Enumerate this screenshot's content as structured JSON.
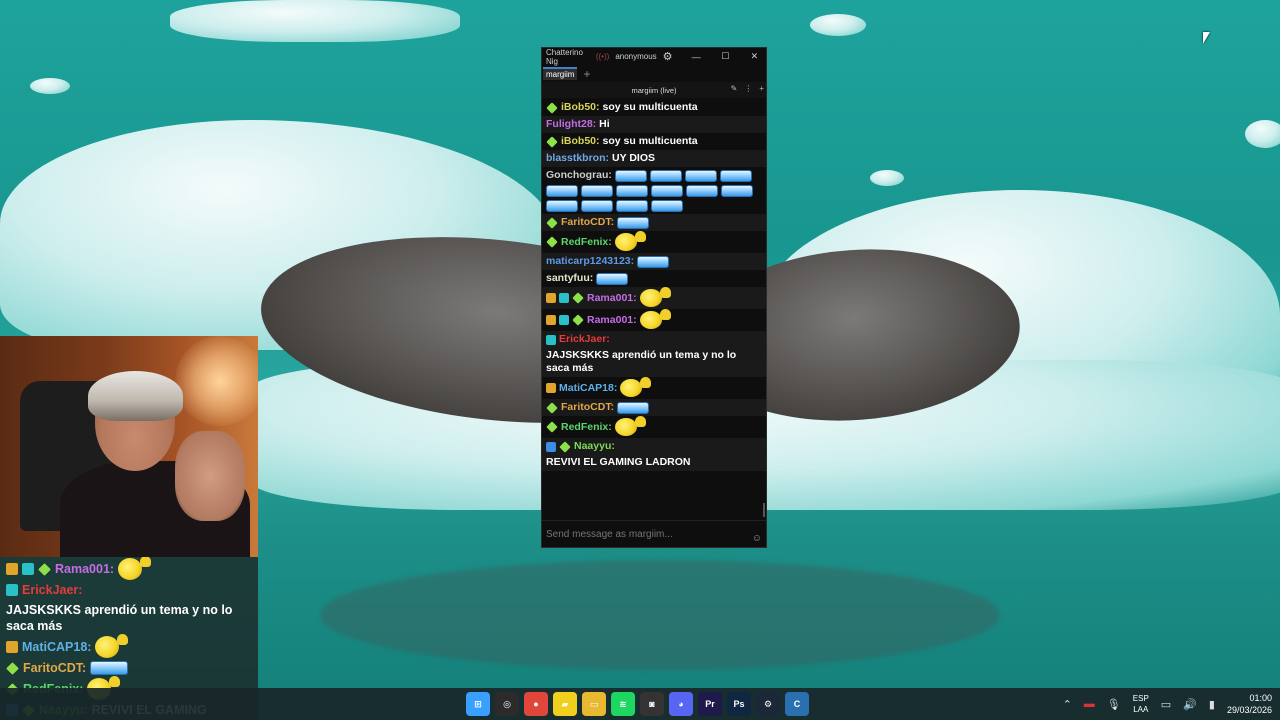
{
  "chat_window": {
    "app_title": "Chatterino Nig",
    "account": "anonymous",
    "tab_label": "margiim",
    "channel_header": "margiim (live)",
    "input_placeholder": "Send message as margiim...",
    "messages": [
      {
        "user": "iBob50:",
        "user_color": "#d8d35b",
        "text": "soy su multicuenta",
        "badges": [
          "diamond"
        ],
        "emotes": []
      },
      {
        "user": "Fulight28:",
        "user_color": "#c66de6",
        "text": "Hi",
        "badges": [],
        "emotes": []
      },
      {
        "user": "iBob50:",
        "user_color": "#d8d35b",
        "text": "soy su multicuenta",
        "badges": [
          "diamond"
        ],
        "emotes": []
      },
      {
        "user": "blasstkbron:",
        "user_color": "#6fa8e6",
        "text": "UY DIOS",
        "badges": [],
        "emotes": []
      },
      {
        "user": "Gonchograu:",
        "user_color": "#cccccc",
        "text": "",
        "badges": [],
        "emotes": [
          "bar",
          "bar",
          "bar",
          "bar",
          "bar",
          "bar",
          "bar",
          "bar",
          "bar",
          "bar",
          "bar",
          "bar",
          "bar",
          "bar"
        ]
      },
      {
        "user": "FaritoCDT:",
        "user_color": "#e0a84a",
        "text": "",
        "badges": [
          "diamond"
        ],
        "emotes": [
          "bar"
        ]
      },
      {
        "user": "RedFenix:",
        "user_color": "#5ad66a",
        "text": "",
        "badges": [
          "diamond"
        ],
        "emotes": [
          "face"
        ]
      },
      {
        "user": "maticarp1243123:",
        "user_color": "#5b9be6",
        "text": "",
        "badges": [],
        "emotes": [
          "bar"
        ]
      },
      {
        "user": "santyfuu:",
        "user_color": "#e6e6c8",
        "text": "",
        "badges": [],
        "emotes": [
          "bar"
        ]
      },
      {
        "user": "Rama001:",
        "user_color": "#c66de6",
        "text": "",
        "badges": [
          "crown",
          "sub",
          "diamond"
        ],
        "emotes": [
          "face"
        ]
      },
      {
        "user": "Rama001:",
        "user_color": "#c66de6",
        "text": "",
        "badges": [
          "crown",
          "sub",
          "diamond"
        ],
        "emotes": [
          "face"
        ]
      },
      {
        "user": "ErickJaer:",
        "user_color": "#e63b3b",
        "text": "JAJSKSKKS aprendió un tema y no lo saca más",
        "badges": [
          "sub"
        ],
        "emotes": []
      },
      {
        "user": "MatiCAP18:",
        "user_color": "#5fb0e6",
        "text": "",
        "badges": [
          "crown"
        ],
        "emotes": [
          "face"
        ]
      },
      {
        "user": "FaritoCDT:",
        "user_color": "#e0a84a",
        "text": "",
        "badges": [
          "diamond"
        ],
        "emotes": [
          "bar"
        ]
      },
      {
        "user": "RedFenix:",
        "user_color": "#5ad66a",
        "text": "",
        "badges": [
          "diamond"
        ],
        "emotes": [
          "face"
        ]
      },
      {
        "user": "Naayyu:",
        "user_color": "#7ed957",
        "text": "REVIVI EL GAMING LADRON",
        "badges": [
          "prime",
          "diamond"
        ],
        "emotes": []
      }
    ]
  },
  "overlay_chat": {
    "messages": [
      {
        "user": "Rama001:",
        "user_color": "#c66de6",
        "text": "",
        "badges": [
          "crown",
          "sub",
          "diamond"
        ],
        "emotes": [
          "face"
        ]
      },
      {
        "user": "ErickJaer:",
        "user_color": "#e63b3b",
        "text": "JAJSKSKKS aprendió un tema y no lo saca más",
        "badges": [
          "sub"
        ],
        "emotes": []
      },
      {
        "user": "MatiCAP18:",
        "user_color": "#5fb0e6",
        "text": "",
        "badges": [
          "crown"
        ],
        "emotes": [
          "face"
        ]
      },
      {
        "user": "FaritoCDT:",
        "user_color": "#e0a84a",
        "text": "",
        "badges": [
          "diamond"
        ],
        "emotes": [
          "bar"
        ]
      },
      {
        "user": "RedFenix:",
        "user_color": "#5ad66a",
        "text": "",
        "badges": [
          "diamond"
        ],
        "emotes": [
          "face"
        ]
      },
      {
        "user": "Naayyu:",
        "user_color": "#7ed957",
        "text": "REVIVI EL GAMING",
        "badges": [
          "prime",
          "diamond"
        ],
        "emotes": []
      }
    ]
  },
  "taskbar": {
    "apps": [
      {
        "name": "windows-start-icon",
        "color": "#3aa0ff",
        "glyph": "⊞"
      },
      {
        "name": "obs-icon",
        "color": "#2b2b2b",
        "glyph": "◎"
      },
      {
        "name": "chrome-icon",
        "color": "#e0463a",
        "glyph": "●"
      },
      {
        "name": "sticky-notes-icon",
        "color": "#f2cf1f",
        "glyph": "▰"
      },
      {
        "name": "file-explorer-icon",
        "color": "#e8b830",
        "glyph": "▭"
      },
      {
        "name": "spotify-icon",
        "color": "#1ed760",
        "glyph": "≋"
      },
      {
        "name": "capture-icon",
        "color": "#333333",
        "glyph": "◙"
      },
      {
        "name": "discord-icon",
        "color": "#5865f2",
        "glyph": "◕"
      },
      {
        "name": "premiere-icon",
        "color": "#1f1a4a",
        "glyph": "Pr"
      },
      {
        "name": "photoshop-icon",
        "color": "#0f2741",
        "glyph": "Ps"
      },
      {
        "name": "steam-icon",
        "color": "#1b2838",
        "glyph": "⚙"
      },
      {
        "name": "chatterino-icon",
        "color": "#2a6fb0",
        "glyph": "C"
      }
    ],
    "lang_top": "ESP",
    "lang_bottom": "LAA",
    "time": "01:00",
    "date": "29/03/2026"
  }
}
